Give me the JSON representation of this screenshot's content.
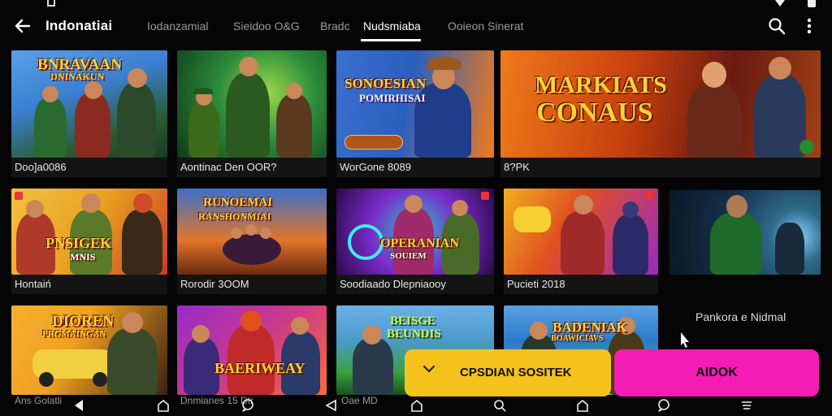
{
  "app": {
    "title": "Indonatiai",
    "tabs": [
      {
        "label": "Iodanzamial",
        "active": false
      },
      {
        "label": "Sieidoo O&G",
        "active": false
      },
      {
        "label": "Bradc",
        "active": false
      },
      {
        "label": "Nudsmiaba",
        "active": true
      },
      {
        "label": "Ooieon Sinerat",
        "active": false
      }
    ]
  },
  "cards": [
    {
      "caption": "Doo]a0086",
      "logo": "BNRAVAAN\nDNINAKUN",
      "palette": [
        "#3a7fd0",
        "#e9b54a"
      ]
    },
    {
      "caption": "Aontinac Den OOR?",
      "logo": "",
      "palette": [
        "#1c7a33",
        "#9bd94a"
      ]
    },
    {
      "caption": "WorGone 8089",
      "logo": "SONOESIAN\nPOMIRHISAI",
      "palette": [
        "#2a5fc0",
        "#f07a1a"
      ]
    },
    {
      "caption": "8?PK",
      "logo": "MARKIATS\nCONAUS",
      "palette": [
        "#c9400e",
        "#f2a22a"
      ]
    },
    {
      "caption": "Hontaiń",
      "logo": "PNSIGEK\nMNIS",
      "palette": [
        "#e8a020",
        "#c93a2a"
      ]
    },
    {
      "caption": "Rorodir 3OOM",
      "logo": "RUNOEMAI\nRANSHONMIAI",
      "palette": [
        "#e3752a",
        "#3b6fc9"
      ]
    },
    {
      "caption": "Soodiaado Dlepniaooy",
      "logo": "OPERANIAN\nSOUIEM",
      "palette": [
        "#7a2ac9",
        "#2ac9c9"
      ]
    },
    {
      "caption": "Pucieti 2018",
      "logo": "",
      "palette": [
        "#f0b020",
        "#9a2ac0"
      ]
    },
    {
      "caption": "",
      "logo": "",
      "palette": [
        "#15304a",
        "#2e6a8a"
      ]
    },
    {
      "caption": "Ans Golatli",
      "logo": "DIOREN\nPRGMAINGAN",
      "palette": [
        "#f0a020",
        "#3a2210"
      ]
    },
    {
      "caption": "Dnmianes 15 Dtr",
      "logo": "BAERIWEAY",
      "palette": [
        "#9a2ac9",
        "#ff6a3a"
      ]
    },
    {
      "caption": "Oae MD",
      "logo": "BEISGE\nBEUNDIS",
      "palette": [
        "#4a9ac9",
        "#3aa040"
      ]
    },
    {
      "caption": "",
      "logo": "BADENIAK\nBOAWICIAVS",
      "palette": [
        "#2a7ac9",
        "#8ac94a"
      ]
    }
  ],
  "side_label": "Pankora e Nidmal",
  "actions": {
    "primary_label": "CPSDIAN SOSITEK",
    "secondary_label": "AIDOK",
    "primary_color": "#f5c21b",
    "secondary_color": "#f51cb5"
  },
  "icons": {
    "back": "arrow-left-icon",
    "search": "search-icon",
    "more": "more-vertical-icon",
    "chevron": "chevron-down-icon"
  }
}
